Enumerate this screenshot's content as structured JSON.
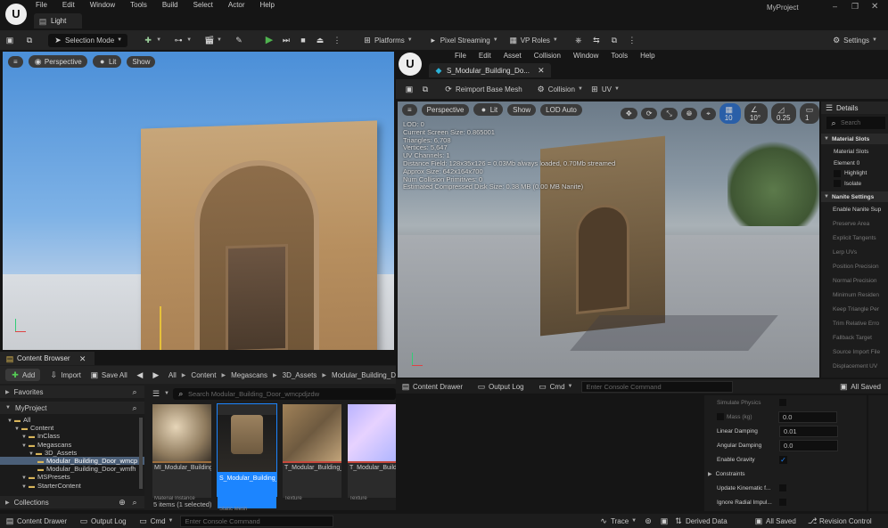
{
  "menubar": {
    "items": [
      "File",
      "Edit",
      "Window",
      "Tools",
      "Build",
      "Select",
      "Actor",
      "Help"
    ],
    "project_name": "MyProject",
    "level_tab": "Light"
  },
  "main_toolbar": {
    "selection_mode": "Selection Mode",
    "platforms": "Platforms",
    "pixel_streaming": "Pixel Streaming",
    "vp_roles": "VP Roles",
    "settings": "Settings"
  },
  "viewport": {
    "perspective": "Perspective",
    "lit": "Lit",
    "show": "Show"
  },
  "content_browser": {
    "tab": "Content Browser",
    "add": "Add",
    "import": "Import",
    "save_all": "Save All",
    "breadcrumb": [
      "All",
      "Content",
      "Megascans",
      "3D_Assets",
      "Modular_Building_D"
    ],
    "search_placeholder": "Search Modular_Building_Door_wmcpdjzdw",
    "favorites": "Favorites",
    "project": "MyProject",
    "collections": "Collections",
    "tree": [
      {
        "label": "All",
        "indent": 0
      },
      {
        "label": "Content",
        "indent": 1
      },
      {
        "label": "InClass",
        "indent": 2
      },
      {
        "label": "Megascans",
        "indent": 2
      },
      {
        "label": "3D_Assets",
        "indent": 3
      },
      {
        "label": "Modular_Building_Door_wmcp",
        "indent": 4
      },
      {
        "label": "Modular_Building_Door_wmfh",
        "indent": 4
      },
      {
        "label": "MSPresets",
        "indent": 2
      },
      {
        "label": "StarterContent",
        "indent": 2
      }
    ],
    "assets": [
      {
        "name": "MI_Modular_Building_Door_wmcpdjzdw_2K",
        "type": "Material Instance",
        "color": "#9e6f3e",
        "selected": false
      },
      {
        "name": "S_Modular_Building_Door_wmcpdjzdw_lod3_Var1",
        "type": "Static Mesh",
        "color": "#1c85ff",
        "selected": true
      },
      {
        "name": "T_Modular_Building_Door_wmcpdjzdw_2K_D",
        "type": "Texture",
        "color": "#c7483b",
        "selected": false
      },
      {
        "name": "T_Modular_Building_Door_wmcpdjzdw_2K_N",
        "type": "Texture",
        "color": "#c7483b",
        "selected": false
      },
      {
        "name": "T_ModularBuilding Door_wmcpdjzdw_2K_DpR",
        "type": "Texture",
        "color": "#c7483b",
        "selected": false
      }
    ],
    "status": "5 items (1 selected)"
  },
  "asset_editor": {
    "tab_title": "S_Modular_Building_Do...",
    "menu": [
      "File",
      "Edit",
      "Asset",
      "Collision",
      "Window",
      "Tools",
      "Help"
    ],
    "reimport": "Reimport Base Mesh",
    "collision": "Collision",
    "uv": "UV",
    "perspective": "Perspective",
    "lit": "Lit",
    "show": "Show",
    "lod_auto": "LOD Auto",
    "grid_value": "10",
    "angle_value": "10°",
    "scale_value": "0.25",
    "camera_value": "1",
    "stats": [
      "LOD: 0",
      "Current Screen Size: 0.865001",
      "Triangles: 6,708",
      "Vertices: 5,647",
      "UV Channels: 1",
      "Distance Field: 128x35x126 = 0.03Mb always loaded, 0.70Mb streamed",
      "Approx Size: 642x164x700",
      "Num Collision Primitives: 0",
      "Estimated Compressed Disk Size: 0.38 MB (0.00 MB Nanite)"
    ],
    "bottom_tabs": {
      "content_drawer": "Content Drawer",
      "output_log": "Output Log",
      "cmd": "Cmd",
      "console_placeholder": "Enter Console Command",
      "all_saved": "All Saved"
    }
  },
  "details": {
    "title": "Details",
    "search_placeholder": "Search",
    "material_slots_section": "Material Slots",
    "material_slots_label": "Material Slots",
    "element0": "Element 0",
    "highlight": "Highlight",
    "isolate": "Isolate",
    "nanite_section": "Nanite Settings",
    "nanite_rows": [
      "Enable Nanite Sup",
      "Preserve Area",
      "Explicit Tangents",
      "Lerp UVs",
      "Position Precision",
      "Normal Precision",
      "Minimum Residen",
      "Keep Triangle Per",
      "Trim Relative Erro",
      "Fallback Target",
      "Source Import File",
      "Displacement UV"
    ]
  },
  "physics": {
    "simulate_physics": "Simulate Physics",
    "mass_label": "Mass (kg)",
    "mass_value": "0.0",
    "linear_damping": "Linear Damping",
    "linear_damping_value": "0.01",
    "angular_damping": "Angular Damping",
    "angular_damping_value": "0.0",
    "enable_gravity": "Enable Gravity",
    "constraints": "Constraints",
    "update_kinematic": "Update Kinematic f...",
    "ignore_radial": "Ignore Radial Impul..."
  },
  "statusbar": {
    "content_drawer": "Content Drawer",
    "output_log": "Output Log",
    "cmd": "Cmd",
    "console_placeholder": "Enter Console Command",
    "trace": "Trace",
    "derived_data": "Derived Data",
    "all_saved": "All Saved",
    "revision_control": "Revision Control"
  },
  "colors": {
    "accent": "#1c85ff",
    "play": "#4fb34f",
    "selected_folder": "#4b5f78"
  }
}
